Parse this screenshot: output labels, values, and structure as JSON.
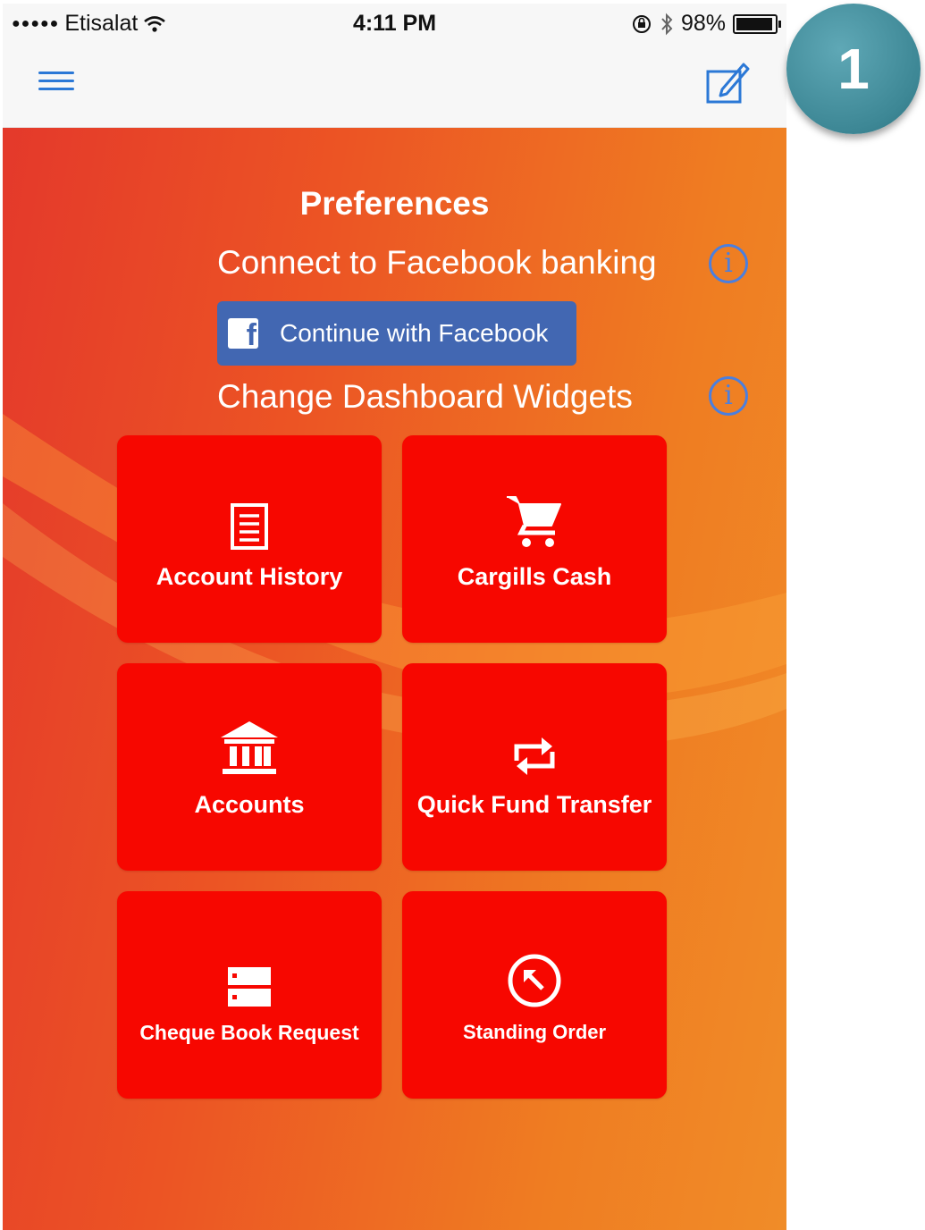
{
  "status_bar": {
    "carrier": "Etisalat",
    "time": "4:11 PM",
    "battery": "98%"
  },
  "nav": {
    "menu_icon": "hamburger-menu-icon",
    "edit_icon": "compose-edit-icon"
  },
  "preferences": {
    "title": "Preferences",
    "facebook_label": "Connect to Facebook banking",
    "facebook_button": "Continue with Facebook",
    "widgets_label": "Change Dashboard Widgets"
  },
  "widgets": [
    {
      "label": "Account History",
      "icon": "document-list-icon"
    },
    {
      "label": "Cargills Cash",
      "icon": "shopping-cart-icon"
    },
    {
      "label": "Accounts",
      "icon": "bank-building-icon"
    },
    {
      "label": "Quick Fund Transfer",
      "icon": "transfer-arrows-icon"
    },
    {
      "label": "Cheque Book Request",
      "icon": "cheque-book-icon"
    },
    {
      "label": "Standing Order",
      "icon": "circle-arrow-icon"
    }
  ],
  "step_badge": "1",
  "colors": {
    "accent_blue": "#2b78d6",
    "facebook_blue": "#4267b2",
    "widget_red": "#f70700",
    "background_orange": "#ef7d22",
    "badge_teal": "#3d8795"
  }
}
